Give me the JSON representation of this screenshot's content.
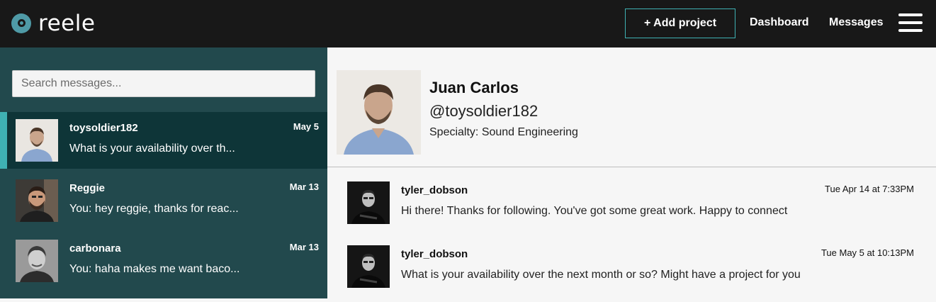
{
  "brand": {
    "name": "reele"
  },
  "topbar": {
    "add_project_label": "+ Add project",
    "dashboard_label": "Dashboard",
    "messages_label": "Messages"
  },
  "sidebar": {
    "search_placeholder": "Search messages...",
    "conversations": [
      {
        "name": "toysoldier182",
        "date": "May 5",
        "preview": "What is your availability over th...",
        "active": true
      },
      {
        "name": "Reggie",
        "date": "Mar 13",
        "preview": "You: hey reggie, thanks for reac...",
        "active": false
      },
      {
        "name": "carbonara",
        "date": "Mar 13",
        "preview": "You: haha makes me want baco...",
        "active": false
      }
    ]
  },
  "profile": {
    "name": "Juan Carlos",
    "handle": "@toysoldier182",
    "specialty": "Specialty: Sound Engineering"
  },
  "messages": [
    {
      "sender": "tyler_dobson",
      "time": "Tue Apr 14 at 7:33PM",
      "text": "Hi there! Thanks for following. You've got some great work. Happy to connect"
    },
    {
      "sender": "tyler_dobson",
      "time": "Tue May 5 at 10:13PM",
      "text": "What is your availability over the next month or so? Might have a project for you"
    }
  ],
  "colors": {
    "topbar": "#181818",
    "sidebar": "#22494d",
    "sidebar_active": "#0e3538",
    "accent": "#3fb1b3",
    "logo": "#4f9aa6"
  }
}
